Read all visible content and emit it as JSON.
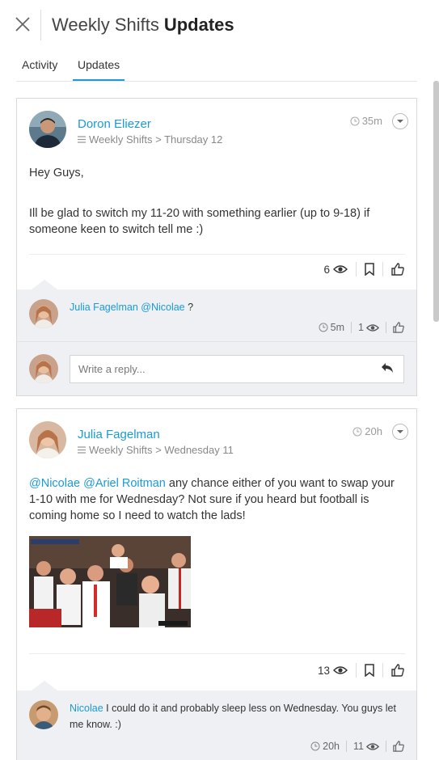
{
  "header": {
    "title_light": "Weekly Shifts",
    "title_bold": "Updates"
  },
  "tabs": [
    {
      "label": "Activity",
      "active": false
    },
    {
      "label": "Updates",
      "active": true
    }
  ],
  "posts": [
    {
      "author": "Doron Eliezer",
      "breadcrumb": "Weekly Shifts > Thursday 12",
      "time": "35m",
      "body_line1": "Hey Guys,",
      "body_line2": "Ill be glad to switch my 11-20 with something earlier (up to 9-18) if someone keen to switch tell me :)",
      "views": "6",
      "comment": {
        "author": "Julia Fagelman",
        "mention": "@Nicolae",
        "text": "?",
        "time": "5m",
        "views": "1"
      },
      "reply_placeholder": "Write a reply..."
    },
    {
      "author": "Julia Fagelman",
      "breadcrumb": "Weekly Shifts > Wednesday 11",
      "time": "20h",
      "mention1": "@Nicolae",
      "mention2": "@Ariel Roitman",
      "body": "any chance either of you want to swap your 1-10 with me for Wednesday? Not sure if you heard but football is coming home so I need to watch the lads!",
      "views": "13",
      "comment": {
        "author": "Nicolae",
        "text": "I could do it and probably sleep less on Wednesday. You guys let me know. :)",
        "time": "20h",
        "views": "11"
      }
    }
  ],
  "colors": {
    "accent": "#1a9ad6",
    "comment_bg": "#eef0f3"
  }
}
